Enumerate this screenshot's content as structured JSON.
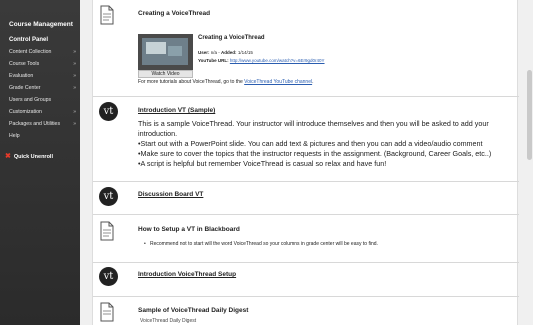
{
  "sidebar": {
    "course_management": "Course Management",
    "control_panel": "Control Panel",
    "items": [
      {
        "label": "Content Collection",
        "arrow": "»"
      },
      {
        "label": "Course Tools",
        "arrow": "»"
      },
      {
        "label": "Evaluation",
        "arrow": "»"
      },
      {
        "label": "Grade Center",
        "arrow": "»"
      },
      {
        "label": "Users and Groups",
        "arrow": ""
      },
      {
        "label": "Customization",
        "arrow": "»"
      },
      {
        "label": "Packages and Utilities",
        "arrow": "»"
      },
      {
        "label": "Help",
        "arrow": ""
      }
    ],
    "unenroll": "Quick Unenroll",
    "unenroll_icon": "x-icon"
  },
  "items": {
    "creating": {
      "title": "Creating a VoiceThread",
      "video_title": "Creating a VoiceThread",
      "user_label": "User:",
      "user_value": "n/a",
      "added_label": "Added:",
      "added_value": "1/14/15",
      "url_label": "YouTube URL:",
      "url_value": "http://www.youtube.com/watch?v=6Er9gd0r40Y",
      "watch_label": "Watch Video",
      "tutorial_prefix": "For more tutorials about VoiceThread, go to the ",
      "tutorial_link": "VoiceThread YouTube channel",
      "tutorial_suffix": "."
    },
    "intro": {
      "title": "Introduction VT (Sample)",
      "lines": [
        "This is a sample VoiceThread.  Your instructor will introduce themselves and then you will be asked to add your",
        "introduction.",
        "•Start out with a PowerPoint slide. You can add text & pictures and then you can add a video/audio comment",
        "•Make sure to cover the topics that the instructor requests in the assignment. (Background, Career Goals, etc..)",
        "•A script is helpful but remember VoiceThread is casual so relax and have fun!"
      ]
    },
    "discussion": {
      "title": "Discussion Board VT"
    },
    "setup": {
      "title": "How to Setup a VT in Blackboard",
      "bullet": "Recommend not to start will the word VoiceThread so your columns in grade center will be easy to find."
    },
    "intro_setup": {
      "title": "Introduction VoiceThread Setup"
    },
    "digest": {
      "title": "Sample of VoiceThread Daily Digest",
      "sub": "VoiceThread Daily Digest"
    }
  },
  "icons": {
    "vt_logo": "vt",
    "document_icon": "document-icon"
  }
}
